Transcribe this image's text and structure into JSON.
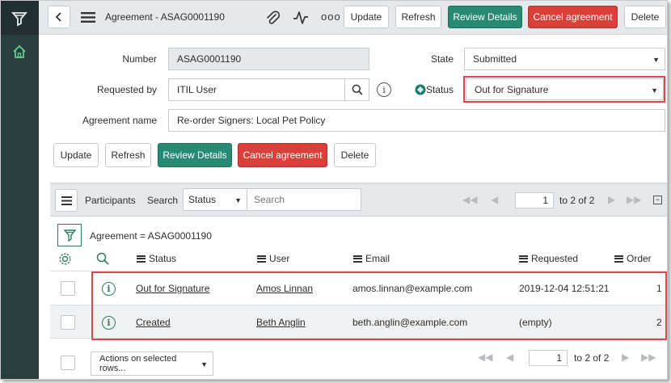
{
  "header": {
    "title": "Agreement - ASAG0001190",
    "buttons": {
      "update": "Update",
      "refresh": "Refresh",
      "review": "Review Details",
      "cancel": "Cancel agreement",
      "delete": "Delete"
    },
    "more": "ooo"
  },
  "form": {
    "number_label": "Number",
    "number_value": "ASAG0001190",
    "requested_by_label": "Requested by",
    "requested_by_value": "ITIL User",
    "agreement_name_label": "Agreement name",
    "agreement_name_value": "Re-order Signers: Local Pet Policy",
    "state_label": "State",
    "state_value": "Submitted",
    "status_label": "Status",
    "status_value": "Out for Signature"
  },
  "form_buttons": {
    "update": "Update",
    "refresh": "Refresh",
    "review": "Review Details",
    "cancel": "Cancel agreement",
    "delete": "Delete"
  },
  "related_list": {
    "title": "Participants",
    "search_label": "Search",
    "search_field_value": "Status",
    "search_placeholder": "Search",
    "page_value": "1",
    "page_text": "to 2 of 2",
    "filter_text": "Agreement = ASAG0001190",
    "columns": {
      "status": "Status",
      "user": "User",
      "email": "Email",
      "requested": "Requested",
      "order": "Order"
    },
    "rows": [
      {
        "status": "Out for Signature",
        "user": "Amos Linnan",
        "email": "amos.linnan@example.com",
        "requested": "2019-12-04 12:51:21",
        "order": "1"
      },
      {
        "status": "Created",
        "user": "Beth Anglin",
        "email": "beth.anglin@example.com",
        "requested": "(empty)",
        "order": "2"
      }
    ],
    "actions_label": "Actions on selected rows...",
    "footer_page_value": "1",
    "footer_page_text": "to 2 of 2"
  },
  "colors": {
    "nav": "#2a3d3f",
    "green": "#278b74",
    "red": "#d9403a",
    "highlight": "#e0454e"
  }
}
